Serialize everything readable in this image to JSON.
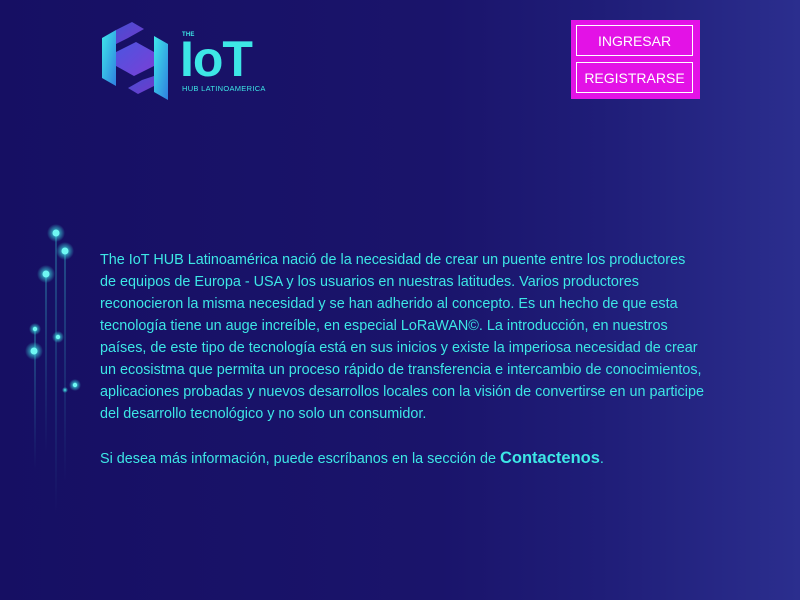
{
  "logo": {
    "the_label": "THE",
    "wordmark": "IoT",
    "subtitle": "HUB LATINOAMERICA"
  },
  "auth": {
    "login_label": "INGRESAR",
    "register_label": "REGISTRARSE"
  },
  "main": {
    "about_text": "The IoT HUB Latinoamérica nació de la necesidad de crear un puente entre los productores de equipos de Europa - USA y los usuarios en nuestras latitudes. Varios productores reconocieron la misma necesidad y se han adherido al concepto. Es un hecho de que esta tecnología tiene un auge increíble, en especial LoRaWAN©. La introducción, en nuestros países, de este tipo de tecnología está en sus inicios y existe la imperiosa necesidad de crear un ecosistma que permita un proceso rápido  de transferencia e intercambio de conocimientos, aplicaciones probadas y  nuevos desarrollos locales con la visión de convertirse  en un participe del desarrollo tecnológico y no solo un consumidor.",
    "contact_prefix": "Si desea más información, puede escríbanos en la sección de ",
    "contact_link": "Contactenos",
    "contact_suffix": "."
  },
  "colors": {
    "accent": "#3de7e6",
    "button_bg": "#e312e6",
    "background": "#1a146b"
  },
  "icons": {
    "logo_mark": "iot-hub-logo-icon",
    "decoration": "glowing-dots-decoration"
  }
}
